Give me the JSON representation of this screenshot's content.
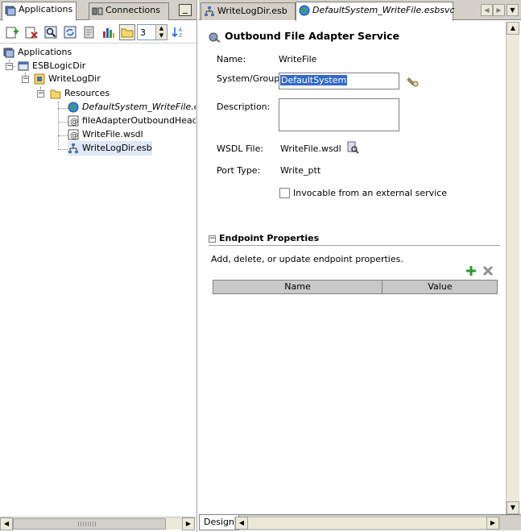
{
  "left_panel": {
    "tabs": [
      {
        "label": "Applications",
        "icon": "applications-icon"
      },
      {
        "label": "Connections",
        "icon": "connections-icon"
      }
    ],
    "toolbar": {
      "spinner_value": "3"
    },
    "tree": {
      "root": "Applications",
      "app": "ESBLogicDir",
      "project": "WriteLogDir",
      "folder": "Resources",
      "items": [
        "DefaultSystem_WriteFile.esbs",
        "fileAdapterOutboundHeader.",
        "WriteFile.wsdl",
        "WriteLogDir.esb"
      ]
    }
  },
  "right_panel": {
    "tabs": [
      {
        "label": "WriteLogDir.esb"
      },
      {
        "label": "DefaultSystem_WriteFile.esbsvc"
      }
    ],
    "title": "Outbound File Adapter Service",
    "form": {
      "name_label": "Name:",
      "name_value": "WriteFile",
      "system_label": "System/Group:",
      "system_value": "DefaultSystem",
      "description_label": "Description:",
      "wsdl_label": "WSDL File:",
      "wsdl_value": "WriteFile.wsdl",
      "port_label": "Port Type:",
      "port_value": "Write_ptt",
      "invocable_label": "Invocable from an external service"
    },
    "endpoint": {
      "section_title": "Endpoint Properties",
      "help_text": "Add, delete, or update endpoint properties.",
      "columns": [
        "Name",
        "Value"
      ]
    },
    "bottom_tab": "Design"
  }
}
